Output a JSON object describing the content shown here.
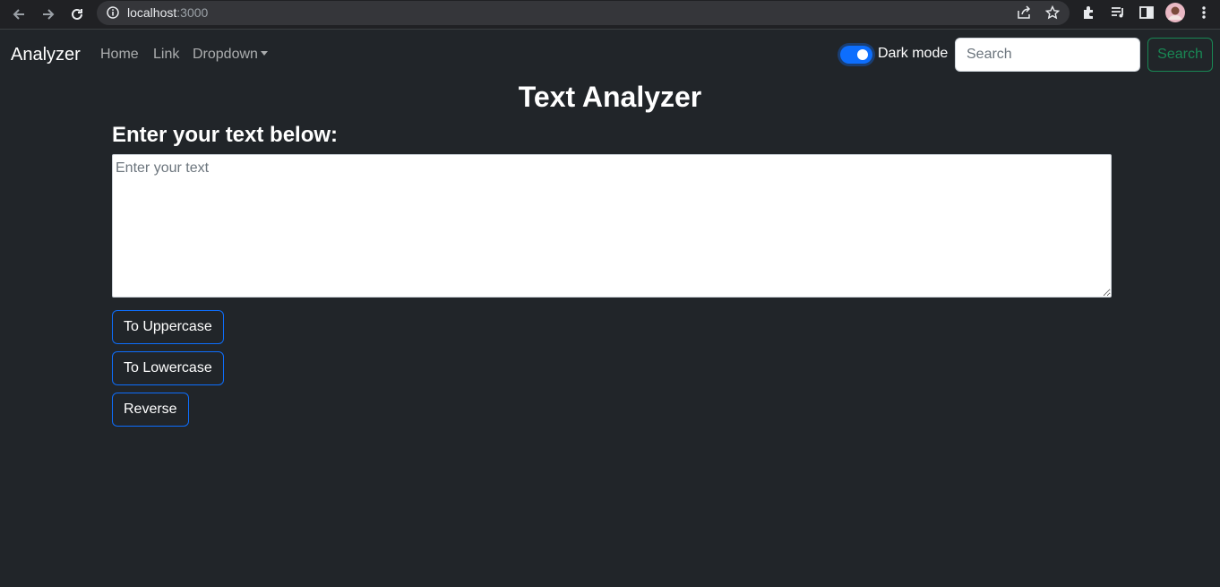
{
  "browser": {
    "url_host": "localhost",
    "url_port": ":3000",
    "icons": [
      "back-arrow-icon",
      "forward-arrow-icon",
      "reload-icon",
      "info-icon",
      "share-icon",
      "star-icon",
      "extensions-icon",
      "media-icon",
      "side-panel-icon",
      "profile-avatar",
      "menu-icon"
    ]
  },
  "navbar": {
    "brand": "Analyzer",
    "links": [
      "Home",
      "Link",
      "Dropdown"
    ],
    "dark_mode_label": "Dark mode",
    "search_placeholder": "Search",
    "search_button": "Search"
  },
  "main": {
    "title": "Text Analyzer",
    "subtitle": "Enter your text below:",
    "textarea_placeholder": "Enter your text",
    "buttons": [
      "To Uppercase",
      "To Lowercase",
      "Reverse"
    ]
  },
  "colors": {
    "background": "#212529",
    "primary": "#0d6efd",
    "success": "#198754"
  }
}
